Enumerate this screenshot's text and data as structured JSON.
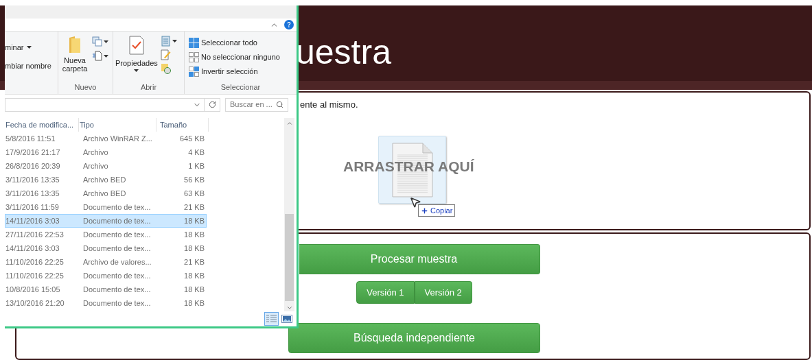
{
  "explorer": {
    "ribbon": {
      "partial_items": [
        {
          "label": "minar",
          "dropdown": true
        },
        {
          "label": "mbiar nombre",
          "dropdown": false
        }
      ],
      "new_group": {
        "label": "Nuevo",
        "button": "Nueva carpeta"
      },
      "open_group": {
        "label": "Abrir",
        "button": "Propiedades"
      },
      "select_group": {
        "label": "Seleccionar",
        "items": [
          "Seleccionar todo",
          "No seleccionar ninguno",
          "Invertir selección"
        ]
      }
    },
    "search": {
      "placeholder": "Buscar en ..."
    },
    "columns": [
      "Fecha de modifica...",
      "Tipo",
      "Tamaño"
    ],
    "rows": [
      {
        "date": "5/8/2016 11:51",
        "type": "Archivo WinRAR Z...",
        "size": "645 KB",
        "selected": false
      },
      {
        "date": "17/9/2016 21:17",
        "type": "Archivo",
        "size": "4 KB",
        "selected": false
      },
      {
        "date": "26/8/2016 20:39",
        "type": "Archivo",
        "size": "1 KB",
        "selected": false
      },
      {
        "date": "3/11/2016 13:35",
        "type": "Archivo BED",
        "size": "56 KB",
        "selected": false
      },
      {
        "date": "3/11/2016 13:35",
        "type": "Archivo BED",
        "size": "63 KB",
        "selected": false
      },
      {
        "date": "3/11/2016 11:59",
        "type": "Documento de tex...",
        "size": "21 KB",
        "selected": false
      },
      {
        "date": "14/11/2016 3:03",
        "type": "Documento de tex...",
        "size": "18 KB",
        "selected": true
      },
      {
        "date": "27/11/2016 22:53",
        "type": "Documento de tex...",
        "size": "18 KB",
        "selected": false
      },
      {
        "date": "14/11/2016 3:03",
        "type": "Documento de tex...",
        "size": "18 KB",
        "selected": false
      },
      {
        "date": "11/10/2016 22:25",
        "type": "Archivo de valores...",
        "size": "21 KB",
        "selected": false
      },
      {
        "date": "11/10/2016 22:25",
        "type": "Documento de tex...",
        "size": "18 KB",
        "selected": false
      },
      {
        "date": "10/8/2016 15:05",
        "type": "Documento de tex...",
        "size": "18 KB",
        "selected": false
      },
      {
        "date": "13/10/2016 21:20",
        "type": "Documento de tex...",
        "size": "18 KB",
        "selected": false
      }
    ]
  },
  "page": {
    "title": "uestra",
    "intro": "ente al mismo.",
    "drop_label": "ARRASTRAR AQUÍ",
    "drag_tooltip": "Copiar",
    "process_button": "Procesar muestra",
    "versions": [
      "Versión 1",
      "Versión 2"
    ],
    "search_button": "Búsqueda independiente"
  }
}
